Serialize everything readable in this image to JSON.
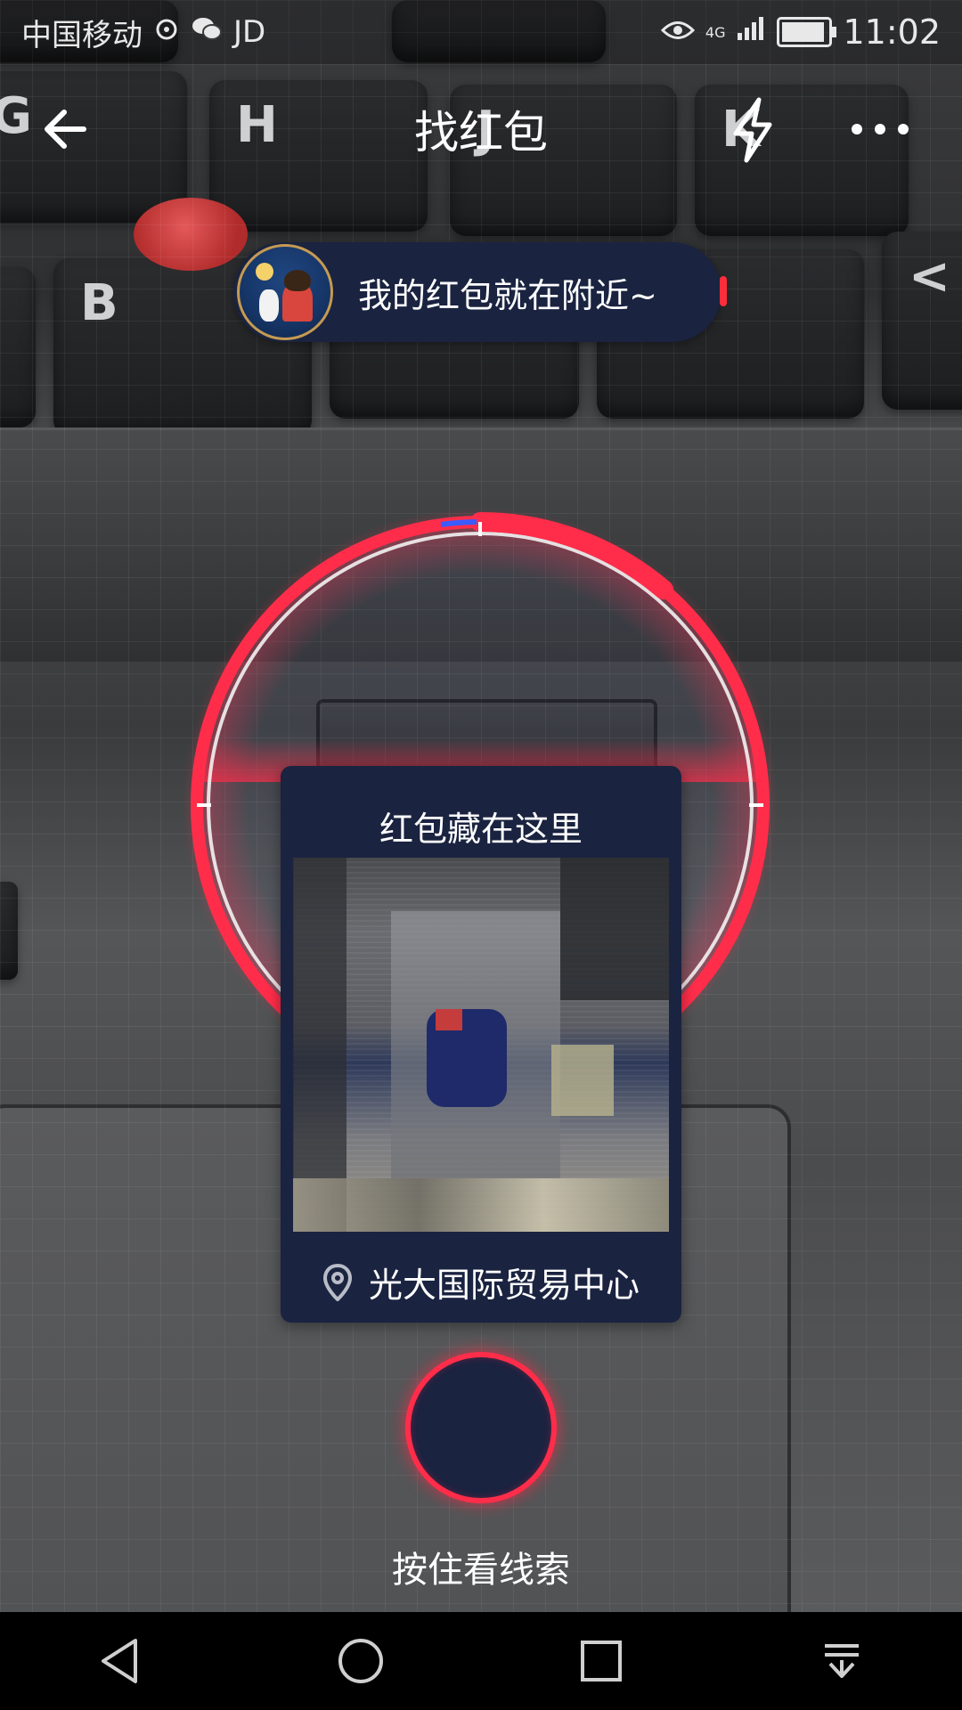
{
  "status_bar": {
    "carrier": "中国移动",
    "app_badge": "JD",
    "network": "4G",
    "time": "11:02"
  },
  "app_bar": {
    "title": "找红包",
    "icons": [
      "back-arrow-icon",
      "flash-icon",
      "more-icon"
    ]
  },
  "hint": {
    "text": "我的红包就在附近~"
  },
  "clue_card": {
    "title": "红包藏在这里",
    "location": "光大国际贸易中心",
    "location_icon": "location-pin-icon"
  },
  "hold_button": {
    "label": "按住看线索"
  },
  "nav_bar": {
    "icons": [
      "back-triangle-icon",
      "home-circle-icon",
      "recents-square-icon",
      "notifications-down-icon"
    ]
  },
  "colors": {
    "accent_red": "#ff2d4a",
    "card_navy": "#1a2340",
    "text_white": "#ffffff"
  }
}
